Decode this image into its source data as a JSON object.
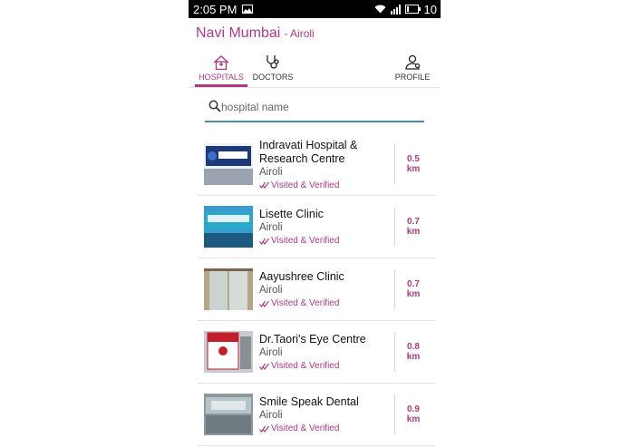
{
  "status_bar": {
    "time": "2:05 PM",
    "battery": "10"
  },
  "header": {
    "city": "Navi Mumbai",
    "area": "- Airoli"
  },
  "tabs": [
    {
      "label": "HOSPITALS",
      "icon": "hospital-icon",
      "active": true
    },
    {
      "label": "DOCTORS",
      "icon": "stethoscope-icon",
      "active": false
    },
    {
      "label": "PROFILE",
      "icon": "profile-icon",
      "active": false
    }
  ],
  "search": {
    "placeholder": "hospital name",
    "value": ""
  },
  "hospitals": [
    {
      "name": "Indravati Hospital & Research Centre",
      "location": "Airoli",
      "status": "Visited & Verified",
      "distance": "0.5",
      "unit": "km"
    },
    {
      "name": "Lisette Clinic",
      "location": "Airoli",
      "status": "Visited & Verified",
      "distance": "0.7",
      "unit": "km"
    },
    {
      "name": "Aayushree Clinic",
      "location": "Airoli",
      "status": "Visited & Verified",
      "distance": "0.7",
      "unit": "km"
    },
    {
      "name": "Dr.Taori's Eye Centre",
      "location": "Airoli",
      "status": "Visited & Verified",
      "distance": "0.8",
      "unit": "km"
    },
    {
      "name": "Smile Speak Dental",
      "location": "Airoli",
      "status": "Visited & Verified",
      "distance": "0.9",
      "unit": "km"
    }
  ],
  "colors": {
    "accent": "#b03a82",
    "search_underline": "#4a90a4",
    "status_bar": "#000000"
  }
}
